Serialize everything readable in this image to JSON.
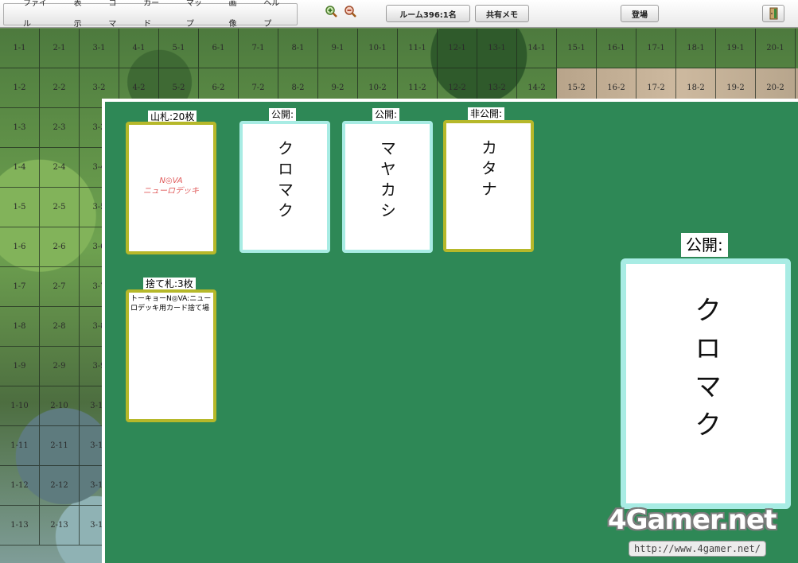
{
  "menu": [
    "ファイル",
    "表示",
    "コマ",
    "カード",
    "マップ",
    "画像",
    "ヘルプ"
  ],
  "toolbar": {
    "zoom_in_icon": "zoom-in-icon",
    "zoom_out_icon": "zoom-out-icon",
    "room_label": "ルーム396:1名",
    "memo_label": "共有メモ",
    "enter_label": "登場",
    "exit_icon": "exit-icon"
  },
  "grid": {
    "cols": 20,
    "rows": 13
  },
  "cards": {
    "deck": {
      "label": "山札:20枚",
      "text_line1": "N◎VA",
      "text_line2": "ニューロデッキ"
    },
    "open1": {
      "label": "公開:",
      "name": "クロマク"
    },
    "open2": {
      "label": "公開:",
      "name": "マヤカシ"
    },
    "hidden": {
      "label": "非公開:",
      "name": "カタナ"
    },
    "discard": {
      "label": "捨て札:3枚",
      "text": "トーキョーN◎VA:ニューロデッキ用カード捨て場"
    },
    "preview": {
      "label": "公開:",
      "name": "クロマク"
    }
  },
  "watermark": {
    "logo": "4Gamer.net",
    "url": "http://www.4gamer.net/"
  },
  "colors": {
    "table_green": "#2e8856",
    "card_yellow_border": "#b6b82a",
    "card_cyan_border": "#a8ece4"
  }
}
